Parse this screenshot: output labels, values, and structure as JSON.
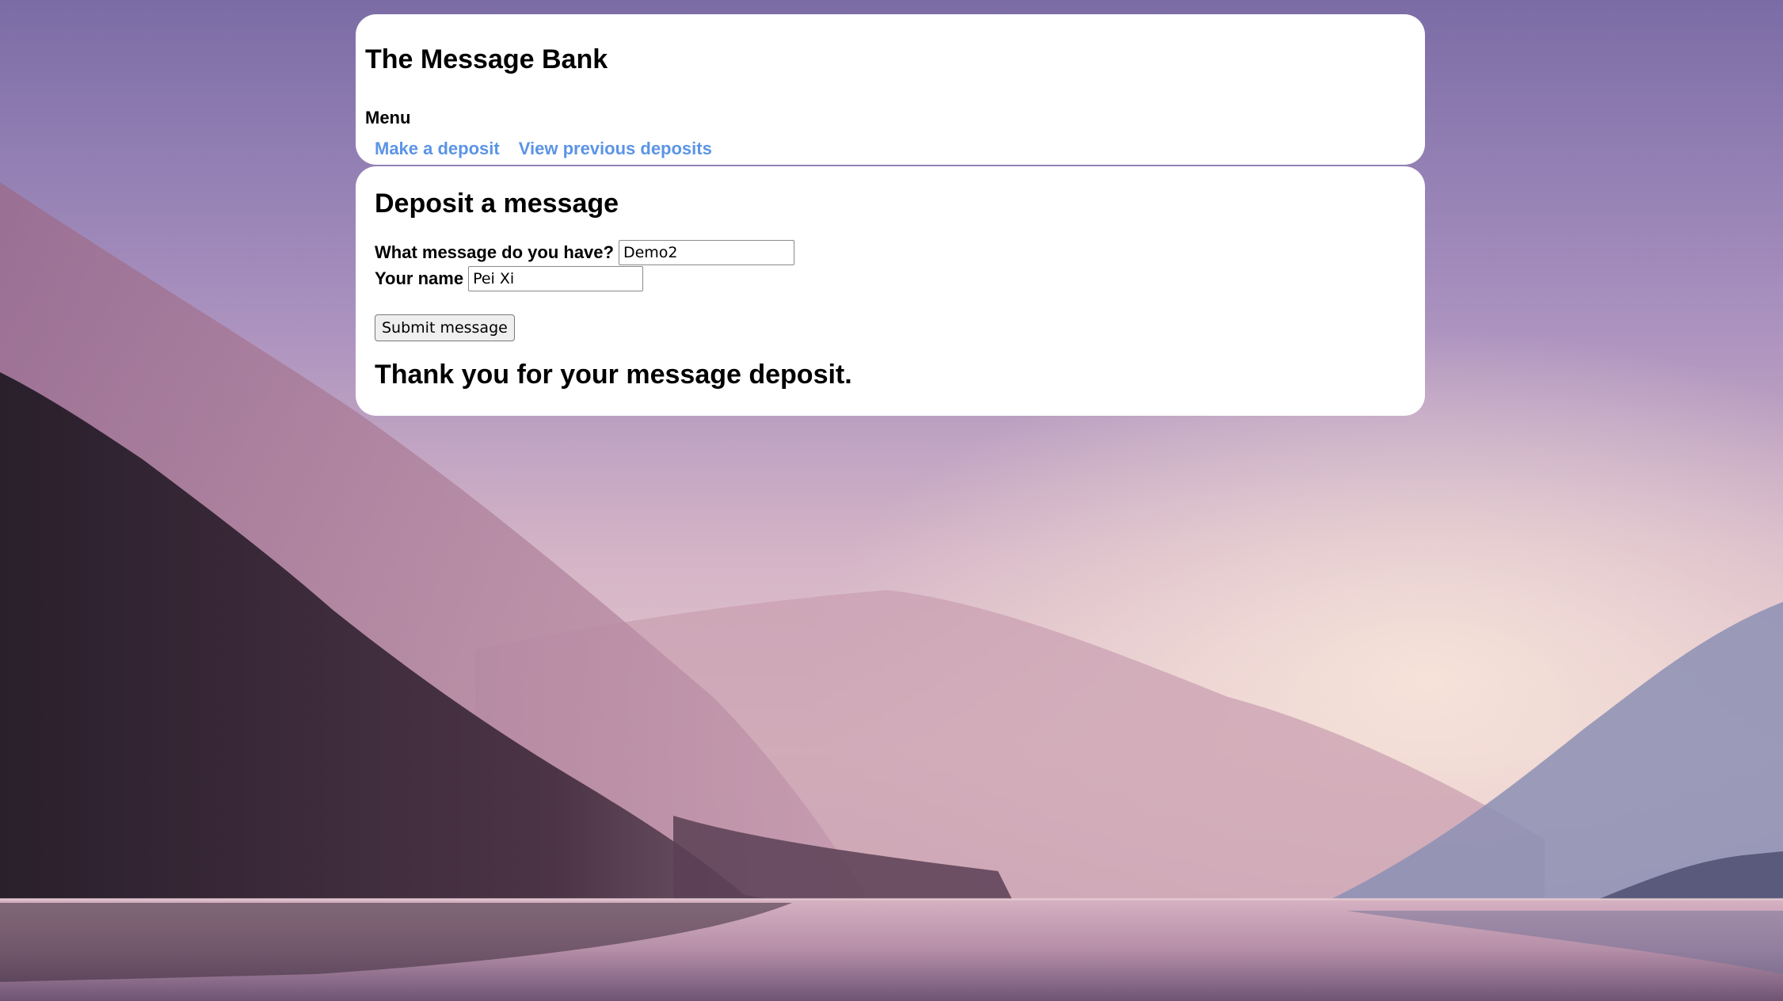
{
  "header": {
    "title": "The Message Bank",
    "menu_heading": "Menu",
    "links": [
      {
        "label": "Make a deposit"
      },
      {
        "label": "View previous deposits"
      }
    ],
    "link_color": "#5b94e6"
  },
  "main": {
    "heading": "Deposit a message",
    "message_label": "What message do you have?",
    "message_value": "Demo2",
    "name_label": "Your name",
    "name_value": "Pei Xi",
    "submit_label": "Submit message",
    "confirmation": "Thank you for your message deposit."
  },
  "background": {
    "scene": "misty-mountain-lake",
    "sky_top": "#7f70a8",
    "sky_mid": "#c9a8c4",
    "glow": "#f2d9cf",
    "forest": "#2e2230",
    "water": "#c7a3b8"
  }
}
